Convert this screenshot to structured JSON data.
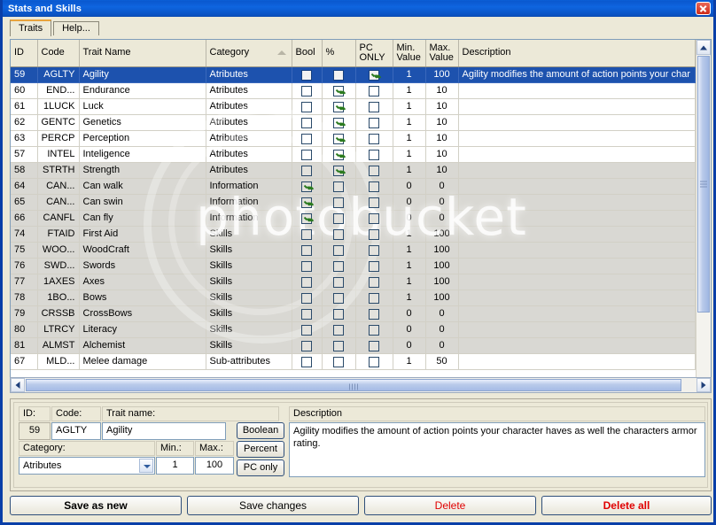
{
  "window": {
    "title": "Stats and Skills",
    "close_label": "close-icon"
  },
  "tabs": [
    {
      "label": "Traits",
      "active": true
    },
    {
      "label": "Help...",
      "active": false
    }
  ],
  "grid": {
    "columns": [
      {
        "key": "id",
        "label": "ID"
      },
      {
        "key": "code",
        "label": "Code"
      },
      {
        "key": "name",
        "label": "Trait Name"
      },
      {
        "key": "cat",
        "label": "Category",
        "sorted": "asc"
      },
      {
        "key": "bool",
        "label": "Bool"
      },
      {
        "key": "pct",
        "label": "%"
      },
      {
        "key": "pc",
        "label": "PC\nONLY"
      },
      {
        "key": "min",
        "label": "Min.\nValue"
      },
      {
        "key": "max",
        "label": "Max.\nValue"
      },
      {
        "key": "desc",
        "label": "Description"
      }
    ],
    "rows": [
      {
        "id": "59",
        "code": "AGLTY",
        "name": "Agility",
        "cat": "Atributes",
        "bool": false,
        "pct": false,
        "pc": true,
        "min": "1",
        "max": "100",
        "desc": "Agility modifies the amount of action points your char",
        "selected": true,
        "shade": "white"
      },
      {
        "id": "60",
        "code": "END...",
        "name": "Endurance",
        "cat": "Atributes",
        "bool": false,
        "pct": true,
        "pc": false,
        "min": "1",
        "max": "10",
        "desc": "",
        "selected": false,
        "shade": "white"
      },
      {
        "id": "61",
        "code": "1LUCK",
        "name": "Luck",
        "cat": "Atributes",
        "bool": false,
        "pct": true,
        "pc": false,
        "min": "1",
        "max": "10",
        "desc": "",
        "selected": false,
        "shade": "white"
      },
      {
        "id": "62",
        "code": "GENTC",
        "name": "Genetics",
        "cat": "Atributes",
        "bool": false,
        "pct": true,
        "pc": false,
        "min": "1",
        "max": "10",
        "desc": "",
        "selected": false,
        "shade": "white"
      },
      {
        "id": "63",
        "code": "PERCP",
        "name": "Perception",
        "cat": "Atributes",
        "bool": false,
        "pct": true,
        "pc": false,
        "min": "1",
        "max": "10",
        "desc": "",
        "selected": false,
        "shade": "white"
      },
      {
        "id": "57",
        "code": "INTEL",
        "name": "Inteligence",
        "cat": "Atributes",
        "bool": false,
        "pct": true,
        "pc": false,
        "min": "1",
        "max": "10",
        "desc": "",
        "selected": false,
        "shade": "white"
      },
      {
        "id": "58",
        "code": "STRTH",
        "name": "Strength",
        "cat": "Atributes",
        "bool": false,
        "pct": true,
        "pc": false,
        "min": "1",
        "max": "10",
        "desc": "",
        "selected": false,
        "shade": "gray"
      },
      {
        "id": "64",
        "code": "CAN...",
        "name": "Can walk",
        "cat": "Information",
        "bool": true,
        "pct": false,
        "pc": false,
        "min": "0",
        "max": "0",
        "desc": "",
        "selected": false,
        "shade": "gray"
      },
      {
        "id": "65",
        "code": "CAN...",
        "name": "Can swin",
        "cat": "Information",
        "bool": true,
        "pct": false,
        "pc": false,
        "min": "0",
        "max": "0",
        "desc": "",
        "selected": false,
        "shade": "gray"
      },
      {
        "id": "66",
        "code": "CANFL",
        "name": "Can fly",
        "cat": "Information",
        "bool": true,
        "pct": false,
        "pc": false,
        "min": "0",
        "max": "0",
        "desc": "",
        "selected": false,
        "shade": "gray"
      },
      {
        "id": "74",
        "code": "FTAID",
        "name": "First Aid",
        "cat": "Skills",
        "bool": false,
        "pct": false,
        "pc": false,
        "min": "1",
        "max": "100",
        "desc": "",
        "selected": false,
        "shade": "gray"
      },
      {
        "id": "75",
        "code": "WOO...",
        "name": "WoodCraft",
        "cat": "Skills",
        "bool": false,
        "pct": false,
        "pc": false,
        "min": "1",
        "max": "100",
        "desc": "",
        "selected": false,
        "shade": "gray"
      },
      {
        "id": "76",
        "code": "SWD...",
        "name": "Swords",
        "cat": "Skills",
        "bool": false,
        "pct": false,
        "pc": false,
        "min": "1",
        "max": "100",
        "desc": "",
        "selected": false,
        "shade": "gray"
      },
      {
        "id": "77",
        "code": "1AXES",
        "name": "Axes",
        "cat": "Skills",
        "bool": false,
        "pct": false,
        "pc": false,
        "min": "1",
        "max": "100",
        "desc": "",
        "selected": false,
        "shade": "gray"
      },
      {
        "id": "78",
        "code": "1BO...",
        "name": "Bows",
        "cat": "Skills",
        "bool": false,
        "pct": false,
        "pc": false,
        "min": "1",
        "max": "100",
        "desc": "",
        "selected": false,
        "shade": "gray"
      },
      {
        "id": "79",
        "code": "CRSSB",
        "name": "CrossBows",
        "cat": "Skills",
        "bool": false,
        "pct": false,
        "pc": false,
        "min": "0",
        "max": "0",
        "desc": "",
        "selected": false,
        "shade": "gray"
      },
      {
        "id": "80",
        "code": "LTRCY",
        "name": "Literacy",
        "cat": "Skills",
        "bool": false,
        "pct": false,
        "pc": false,
        "min": "0",
        "max": "0",
        "desc": "",
        "selected": false,
        "shade": "gray"
      },
      {
        "id": "81",
        "code": "ALMST",
        "name": "Alchemist",
        "cat": "Skills",
        "bool": false,
        "pct": false,
        "pc": false,
        "min": "0",
        "max": "0",
        "desc": "",
        "selected": false,
        "shade": "gray"
      },
      {
        "id": "67",
        "code": "MLD...",
        "name": "Melee damage",
        "cat": "Sub-attributes",
        "bool": false,
        "pct": false,
        "pc": false,
        "min": "1",
        "max": "50",
        "desc": "",
        "selected": false,
        "shade": "white"
      }
    ]
  },
  "watermark": {
    "text": "photobucket"
  },
  "form": {
    "id_label": "ID:",
    "code_label": "Code:",
    "name_label": "Trait name:",
    "category_label": "Category:",
    "min_label": "Min.:",
    "max_label": "Max.:",
    "description_label": "Description",
    "id_value": "59",
    "code_value": "AGLTY",
    "name_value": "Agility",
    "category_value": "Atributes",
    "min_value": "1",
    "max_value": "100",
    "description_value": "Agility modifies the amount of action points your character haves as well the characters armor rating.",
    "boolean_btn": "Boolean",
    "percent_btn": "Percent",
    "pconly_btn": "PC only"
  },
  "footer": {
    "save_as_new": "Save as new",
    "save_changes": "Save changes",
    "delete": "Delete",
    "delete_all": "Delete all"
  },
  "colors": {
    "titlebar": "#0a58cf",
    "selection": "#1d52ae",
    "danger": "#e00000",
    "accent_tab": "#e8a33d"
  }
}
